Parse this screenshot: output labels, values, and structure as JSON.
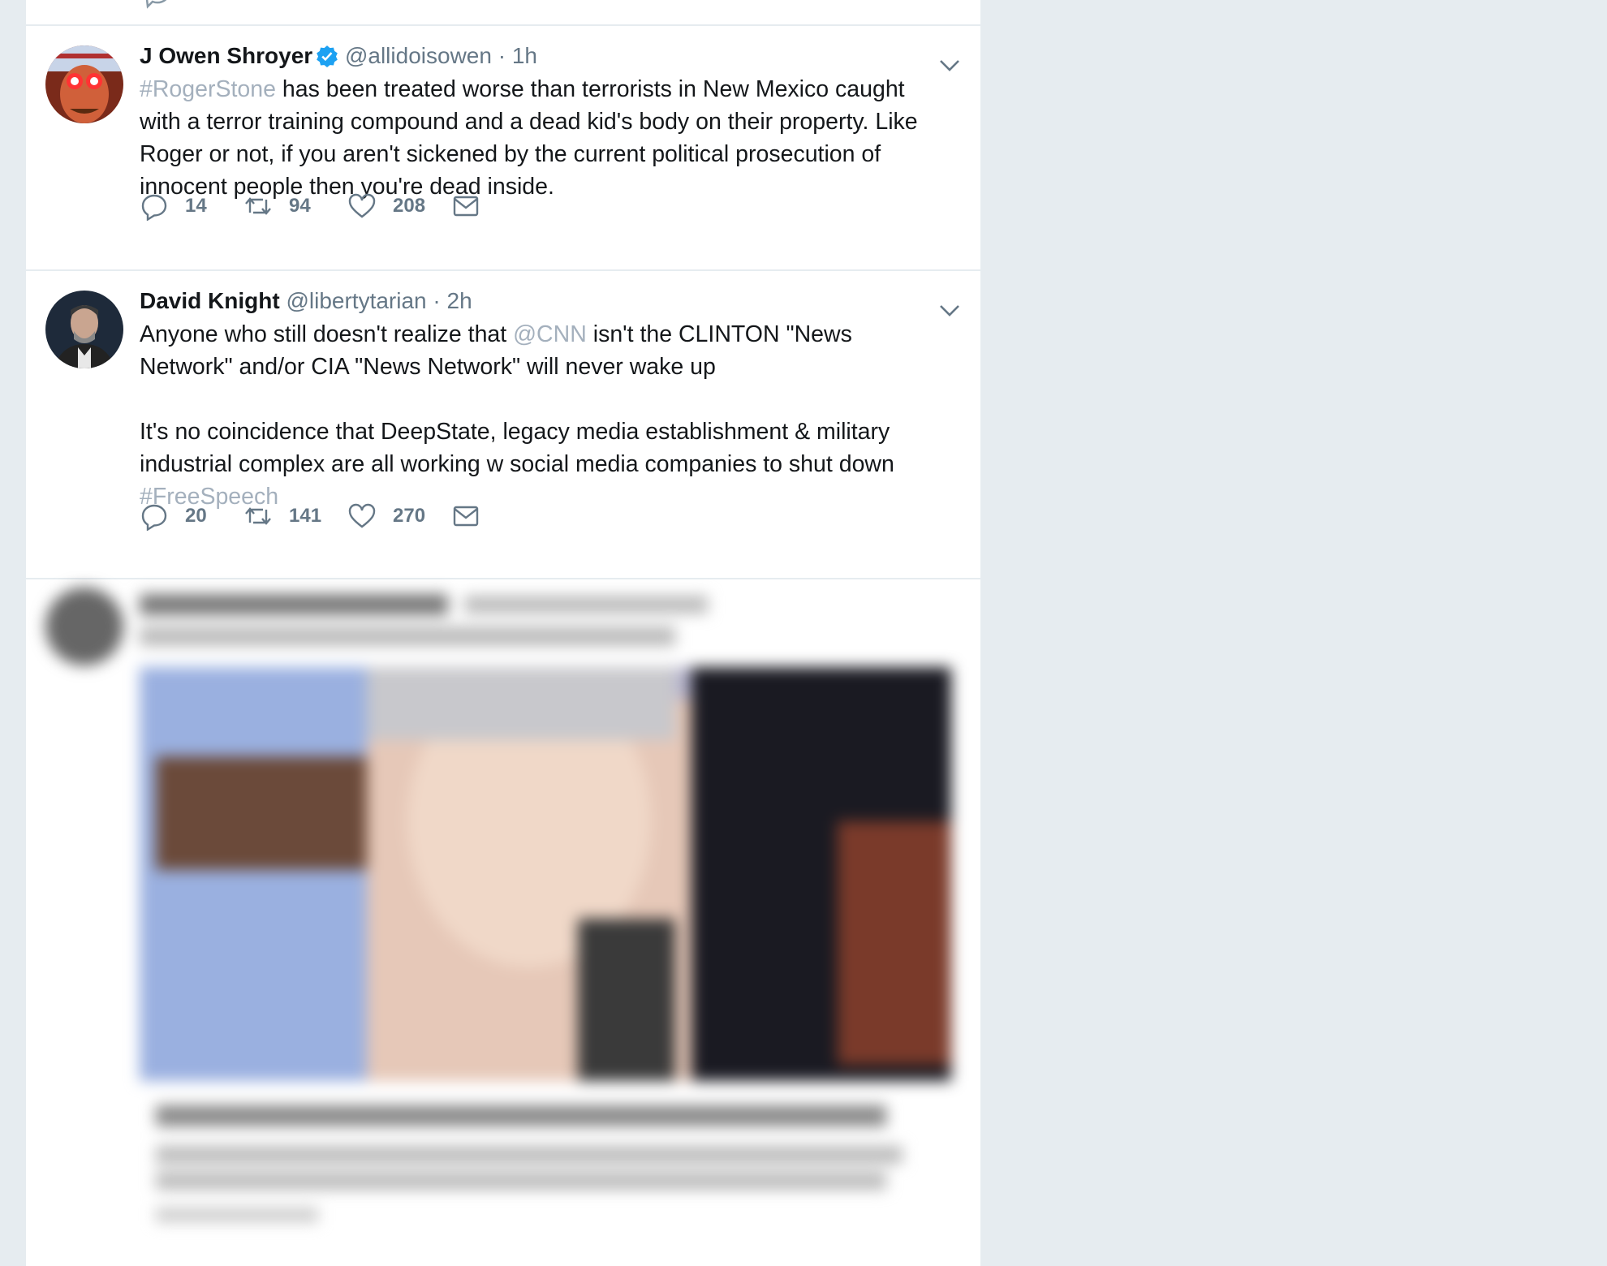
{
  "tweets": [
    {
      "name": "J Owen Shroyer",
      "verified": true,
      "handle": "@allidoisowen",
      "time": "· 1h",
      "text_parts": {
        "link1": "#RogerStone",
        "body1": " has been treated worse than terrorists in New Mexico caught with a terror training compound and a dead kid's body on their property. Like Roger or not, if you aren't sickened by the current political prosecution of innocent people then you're dead inside."
      },
      "replies": "14",
      "retweets": "94",
      "likes": "208"
    },
    {
      "name": "David Knight",
      "verified": false,
      "handle": "@libertytarian",
      "time": "· 2h",
      "text_parts": {
        "body1": "Anyone who still doesn't realize that ",
        "link1": "@CNN",
        "body2": " isn't the CLINTON \"News Network\" and/or CIA \"News Network\" will never wake up\n\nIt's no coincidence that DeepState, legacy media establishment & military industrial complex are all working w social media companies to shut down ",
        "link2": "#FreeSpeech"
      },
      "replies": "20",
      "retweets": "141",
      "likes": "270"
    }
  ],
  "icons": {
    "reply": "reply-icon",
    "retweet": "retweet-icon",
    "like": "heart-icon",
    "dm": "envelope-icon",
    "caret": "chevron-down-icon",
    "verified": "verified-badge-icon"
  },
  "colors": {
    "background": "#e6ecf0",
    "link": "#a4b0bd",
    "text": "#14171a",
    "secondary": "#657786",
    "verified": "#1da1f2"
  }
}
